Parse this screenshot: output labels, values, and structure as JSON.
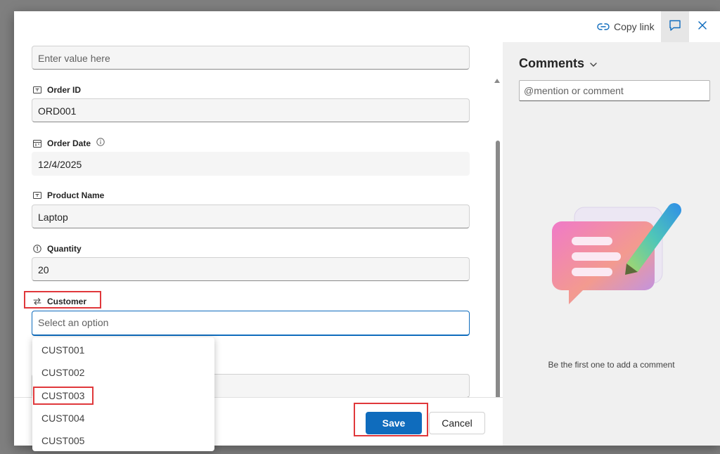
{
  "topbar": {
    "copy_link_label": "Copy link"
  },
  "form": {
    "first_field_placeholder": "Enter value here",
    "order_id": {
      "label": "Order ID",
      "value": "ORD001"
    },
    "order_date": {
      "label": "Order Date",
      "value": "12/4/2025"
    },
    "product_name": {
      "label": "Product Name",
      "value": "Laptop"
    },
    "quantity": {
      "label": "Quantity",
      "value": "20"
    },
    "customer": {
      "label": "Customer",
      "placeholder": "Select an option"
    }
  },
  "dropdown": {
    "options": [
      "CUST001",
      "CUST002",
      "CUST003",
      "CUST004",
      "CUST005"
    ]
  },
  "footer": {
    "save_label": "Save",
    "cancel_label": "Cancel"
  },
  "comments": {
    "title": "Comments",
    "input_placeholder": "@mention or comment",
    "empty_text": "Be the first one to add a comment"
  },
  "colors": {
    "primary": "#0f6cbd",
    "highlight_annotation": "#e0383b",
    "comments_bg": "#f0f0f0"
  },
  "icons": {
    "copy_link": "link-icon",
    "comment": "comment-icon",
    "close": "close-icon",
    "text_field": "text-field-icon",
    "date_field": "calendar-icon",
    "number_field": "number-icon",
    "lookup_field": "lookup-arrows-icon",
    "info": "info-icon",
    "chevron": "chevron-down-icon"
  }
}
